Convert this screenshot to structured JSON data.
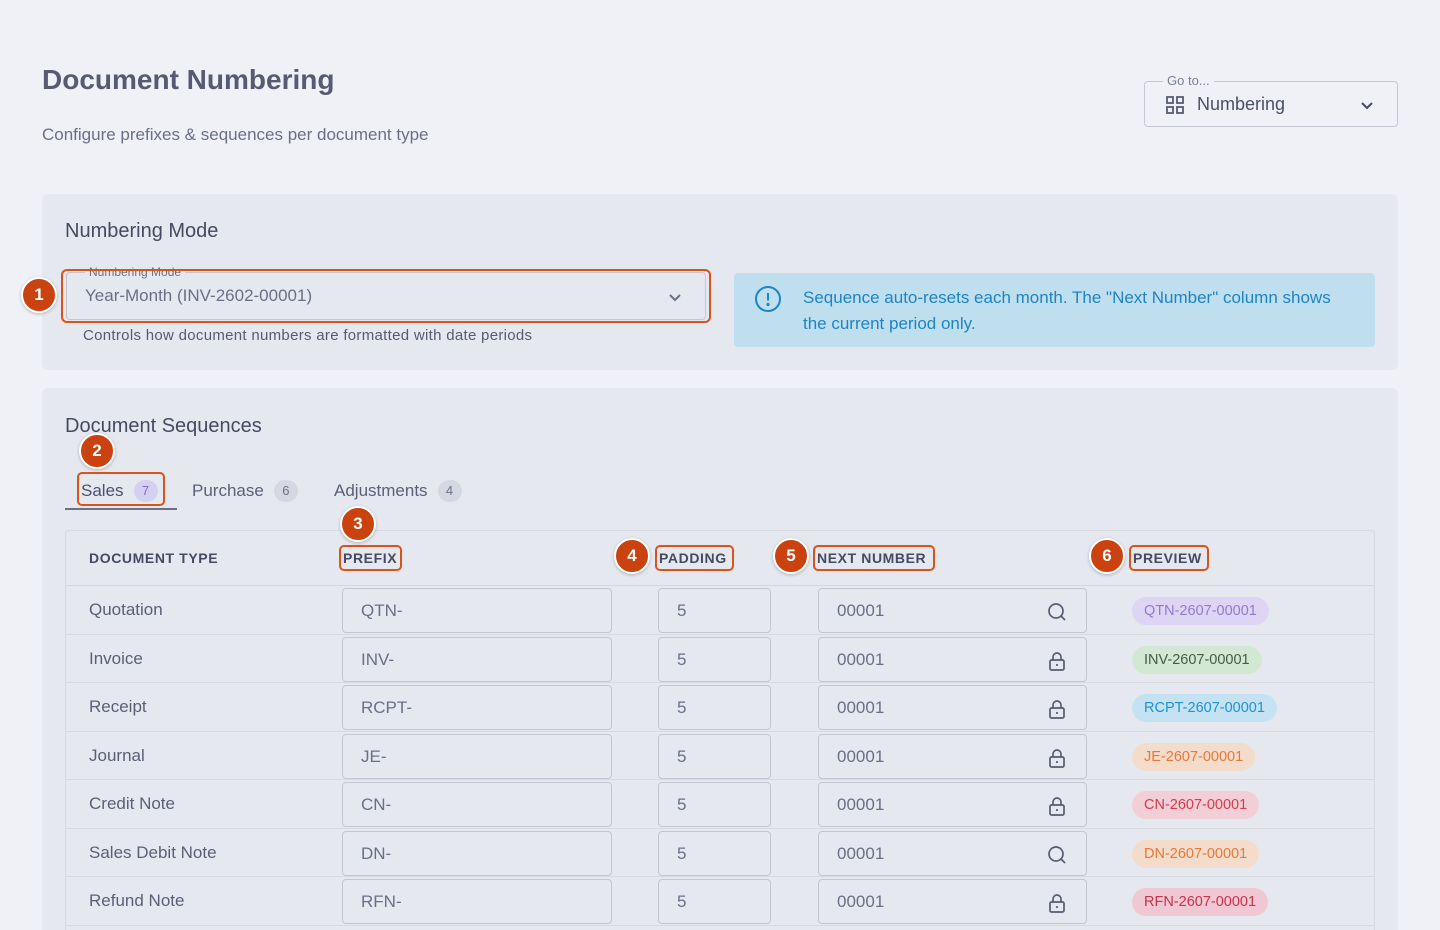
{
  "header": {
    "title": "Document Numbering",
    "subtitle": "Configure prefixes & sequences per document type"
  },
  "goto": {
    "label": "Go to...",
    "value": "Numbering",
    "icon": "grid-icon"
  },
  "mode_card": {
    "title": "Numbering Mode",
    "select_label": "Numbering Mode",
    "select_value": "Year-Month (INV-2602-00001)",
    "helper": "Controls how document numbers are formatted with date periods",
    "info_text": "Sequence auto-resets each month. The \"Next Number\" column shows the current period only."
  },
  "sequences": {
    "title": "Document Sequences",
    "tabs": [
      {
        "label": "Sales",
        "count": "7"
      },
      {
        "label": "Purchase",
        "count": "6"
      },
      {
        "label": "Adjustments",
        "count": "4"
      }
    ],
    "columns": {
      "type": "DOCUMENT TYPE",
      "prefix": "PREFIX",
      "padding": "PADDING",
      "next": "NEXT NUMBER",
      "preview": "PREVIEW"
    },
    "rows": [
      {
        "type": "Quotation",
        "prefix": "QTN-",
        "padding": "5",
        "next": "00001",
        "icon": "search-icon",
        "preview": "QTN-2607-00001",
        "chip_bg": "#ded4f3",
        "chip_fg": "#9579d0"
      },
      {
        "type": "Invoice",
        "prefix": "INV-",
        "padding": "5",
        "next": "00001",
        "icon": "lock-icon",
        "preview": "INV-2607-00001",
        "chip_bg": "#d2e8d2",
        "chip_fg": "#4a5a48"
      },
      {
        "type": "Receipt",
        "prefix": "RCPT-",
        "padding": "5",
        "next": "00001",
        "icon": "lock-icon",
        "preview": "RCPT-2607-00001",
        "chip_bg": "#c4e2f2",
        "chip_fg": "#1e93d0"
      },
      {
        "type": "Journal",
        "prefix": "JE-",
        "padding": "5",
        "next": "00001",
        "icon": "lock-icon",
        "preview": "JE-2607-00001",
        "chip_bg": "#f4dccb",
        "chip_fg": "#e8783a"
      },
      {
        "type": "Credit Note",
        "prefix": "CN-",
        "padding": "5",
        "next": "00001",
        "icon": "lock-icon",
        "preview": "CN-2607-00001",
        "chip_bg": "#f2cfd6",
        "chip_fg": "#d63b4d"
      },
      {
        "type": "Sales Debit Note",
        "prefix": "DN-",
        "padding": "5",
        "next": "00001",
        "icon": "search-icon",
        "preview": "DN-2607-00001",
        "chip_bg": "#f4dccb",
        "chip_fg": "#e8783a"
      },
      {
        "type": "Refund Note",
        "prefix": "RFN-",
        "padding": "5",
        "next": "00001",
        "icon": "lock-icon",
        "preview": "RFN-2607-00001",
        "chip_bg": "#f0c8d3",
        "chip_fg": "#c8334b"
      }
    ]
  },
  "annotations": [
    "1",
    "2",
    "3",
    "4",
    "5",
    "6"
  ],
  "colors": {
    "highlight": "#d8541c",
    "badge": "#c9420f",
    "info_bg": "#c0dfee",
    "info_text": "#1d84c6"
  }
}
